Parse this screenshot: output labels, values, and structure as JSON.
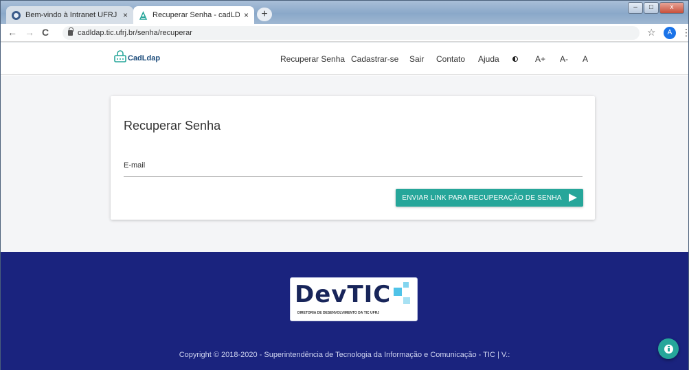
{
  "browser": {
    "tabs": [
      {
        "title": "Bem-vindo à Intranet UFRJ | Intra",
        "close": "×"
      },
      {
        "title": "Recuperar Senha - cadLDAP",
        "close": "×"
      }
    ],
    "new_tab": "+",
    "url": "cadldap.tic.ufrj.br/senha/recuperar",
    "avatar_letter": "A",
    "back": "←",
    "forward": "→",
    "reload": "C",
    "star": "☆",
    "menu": "⋮"
  },
  "header": {
    "logo_text": "CadLdap",
    "menu": {
      "recuperar": "Recuperar Senha",
      "cadastrar": "Cadastrar-se",
      "sair": "Sair",
      "contato": "Contato",
      "ajuda": "Ajuda",
      "font_up": "A+",
      "font_down": "A-",
      "font_reset": "A"
    }
  },
  "form": {
    "title": "Recuperar Senha",
    "email_label": "E-mail",
    "submit_label": "ENVIAR LINK PARA RECUPERAÇÃO DE SENHA"
  },
  "footer": {
    "logo_word": "DevTIC",
    "logo_subtitle": "DIRETORIA DE DESENVOLVIMENTO DA TIC UFRJ",
    "copyright": "Copyright © 2018-2020 - Superintendência de Tecnologia da Informação e Comunicação - TIC | V.:"
  },
  "colors": {
    "accent": "#26a69a",
    "footer_bg": "#1a237e"
  }
}
